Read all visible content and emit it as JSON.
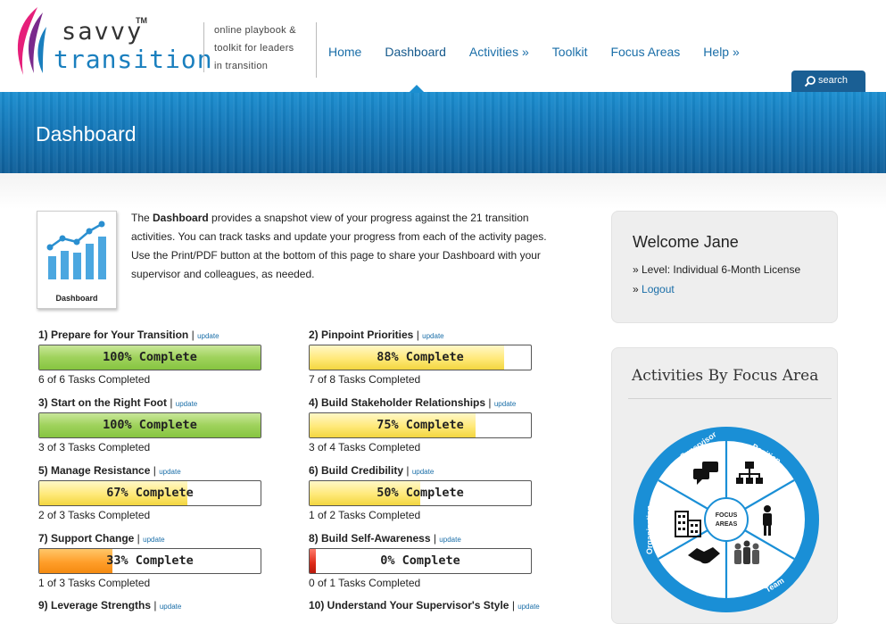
{
  "brand": {
    "name_top": "savvy",
    "name_tm": "TM",
    "name_bottom": "transition",
    "tagline": [
      "online playbook &",
      "toolkit for leaders",
      "in transition"
    ]
  },
  "nav": [
    {
      "label": "Home"
    },
    {
      "label": "Dashboard",
      "active": true
    },
    {
      "label": "Activities »"
    },
    {
      "label": "Toolkit"
    },
    {
      "label": "Focus Areas"
    },
    {
      "label": "Help »"
    }
  ],
  "search": {
    "label": "search"
  },
  "page_title": "Dashboard",
  "intro": {
    "thumb_label": "Dashboard",
    "text_lead": "The ",
    "text_bold": "Dashboard",
    "text_rest": " provides a snapshot view of your progress against the 21 transition activities. You can track tasks and update your progress from each of the activity pages. Use the Print/PDF button at the bottom of this page to share your Dashboard with your supervisor and colleagues, as needed."
  },
  "update_label": "update",
  "activities": [
    {
      "title": "1) Prepare for Your Transition",
      "percent": 100,
      "bar_label": "100% Complete",
      "color": "green",
      "count": "6 of 6 Tasks Completed"
    },
    {
      "title": "2) Pinpoint Priorities",
      "percent": 88,
      "bar_label": "88% Complete",
      "color": "yellow",
      "count": "7 of 8 Tasks Completed"
    },
    {
      "title": "3) Start on the Right Foot",
      "percent": 100,
      "bar_label": "100% Complete",
      "color": "green",
      "count": "3 of 3 Tasks Completed"
    },
    {
      "title": "4) Build Stakeholder Relationships",
      "percent": 75,
      "bar_label": "75% Complete",
      "color": "yellow",
      "count": "3 of 4 Tasks Completed"
    },
    {
      "title": "5) Manage Resistance",
      "percent": 67,
      "bar_label": "67% Complete",
      "color": "yellow",
      "count": "2 of 3 Tasks Completed"
    },
    {
      "title": "6) Build Credibility",
      "percent": 50,
      "bar_label": "50% Complete",
      "color": "yellow",
      "count": "1 of 2 Tasks Completed"
    },
    {
      "title": "7) Support Change",
      "percent": 33,
      "bar_label": "33% Complete",
      "color": "orange",
      "count": "1 of 3 Tasks Completed"
    },
    {
      "title": "8) Build Self-Awareness",
      "percent": 0,
      "bar_label": "0% Complete",
      "color": "red",
      "count": "0 of 1 Tasks Completed"
    },
    {
      "title": "9) Leverage Strengths",
      "percent": null,
      "bar_label": "",
      "color": "",
      "count": ""
    },
    {
      "title": "10) Understand Your Supervisor's Style",
      "percent": null,
      "bar_label": "",
      "color": "",
      "count": ""
    }
  ],
  "welcome": {
    "title": "Welcome Jane",
    "level": "» Level: Individual 6-Month License",
    "logout_prefix": "» ",
    "logout": "Logout"
  },
  "focus": {
    "title": "Activities By Focus Area",
    "center": [
      "FOCUS",
      "AREAS"
    ],
    "segments": [
      "Supervisor",
      "Position",
      "Self",
      "Team",
      "Stakeholder",
      "Organization"
    ]
  },
  "colors": {
    "link": "#1a6ea8",
    "banner": "#1477b8",
    "green": "#9fd25c",
    "yellow": "#ffe979",
    "orange": "#ff9e2a",
    "red": "#dd2a18",
    "wheel": "#1a8fd6"
  }
}
